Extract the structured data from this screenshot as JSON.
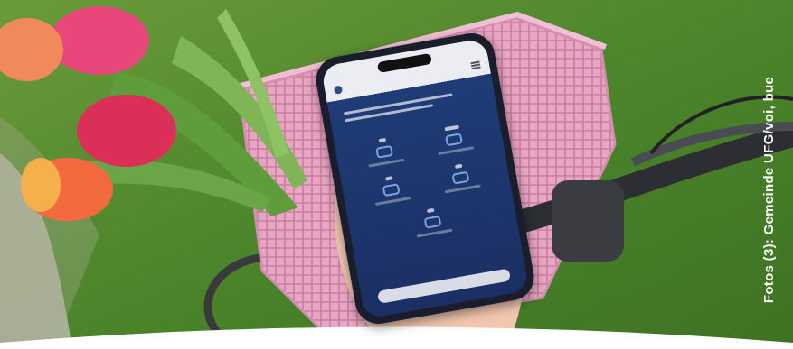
{
  "photo_credit": "Fotos (3): Gemeinde UFG/voi, bue",
  "colors": {
    "grass": "#4f8a2e",
    "basket": "#e9a9c4",
    "tulip_red": "#e23e6a",
    "tulip_orange": "#f07a3a",
    "phone_screen": "#1f3c77",
    "credit_text": "#ffffff"
  }
}
